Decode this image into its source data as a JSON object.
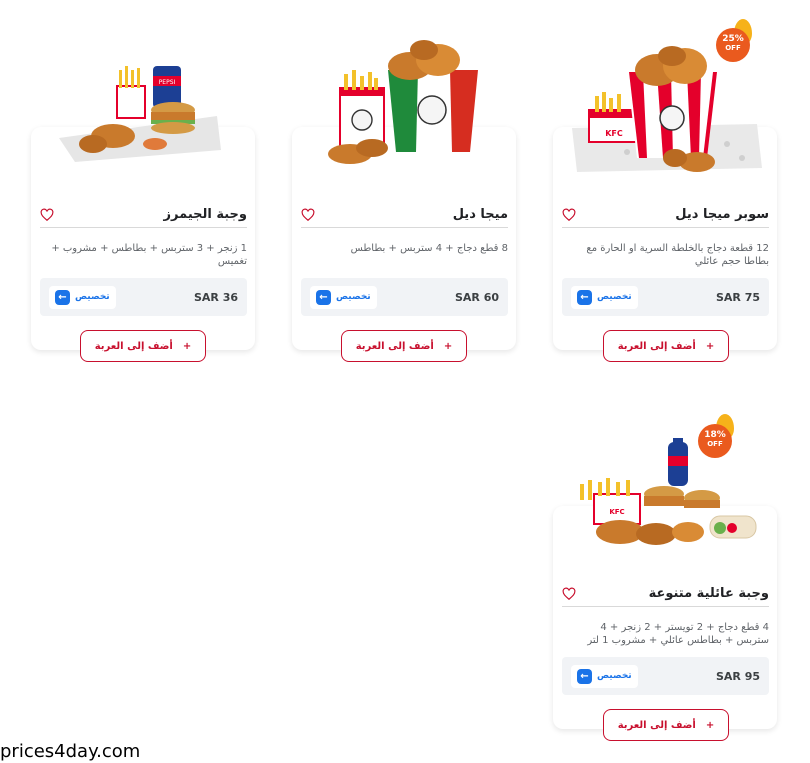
{
  "cards": [
    {
      "title": "سوبر ميجا ديل",
      "description": "12 قطعة دجاج بالخلطة السرية او الحارة مع بطاطا حجم عائلي",
      "price": "SAR 75",
      "customize_label": "تخصيص",
      "add_label": "أضف إلى العربة",
      "badge": {
        "percent": "25%",
        "off": "OFF"
      }
    },
    {
      "title": "ميجا ديل",
      "description": "8 قطع دجاج + 4 ستربس + بطاطس",
      "price": "SAR 60",
      "customize_label": "تخصيص",
      "add_label": "أضف إلى العربة"
    },
    {
      "title": "وجبة الجيمرز",
      "description": "1 زنجر + 3 ستربس + بطاطس + مشروب + تغميس",
      "price": "SAR 36",
      "customize_label": "تخصيص",
      "add_label": "أضف إلى العربة"
    },
    {
      "title": "وجبة عائلية متنوعة",
      "description": "4 قطع دجاج + 2 تويستر + 2 زنجر + 4 ستربس + بطاطس عائلي + مشروب 1 لتر",
      "price": "SAR 95",
      "customize_label": "تخصيص",
      "add_label": "أضف إلى العربة",
      "badge": {
        "percent": "18%",
        "off": "OFF"
      }
    }
  ],
  "watermark": "prices4day.com",
  "colors": {
    "accent_red": "#c8102e",
    "accent_blue": "#1a73e8",
    "badge_orange": "#ea5a1e",
    "price_bg": "#f1f3f6"
  },
  "icons": {
    "favorite": "heart-outline-icon",
    "customize": "arrow-left-icon",
    "add": "plus-icon"
  }
}
